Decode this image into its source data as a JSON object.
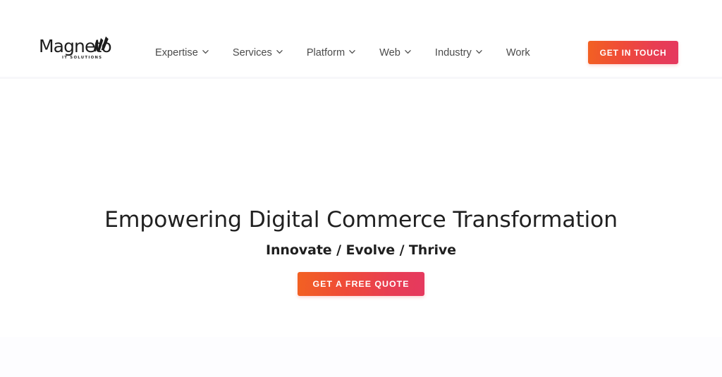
{
  "site": {
    "brand_name": "Magneto",
    "brand_tagline": "IT SOLUTIONS",
    "logo_icon": "magneto-swoosh-icon"
  },
  "header": {
    "nav_items": [
      {
        "label": "Expertise",
        "has_dropdown": true,
        "icon": "chevron-down-icon"
      },
      {
        "label": "Services",
        "has_dropdown": true,
        "icon": "chevron-down-icon"
      },
      {
        "label": "Platform",
        "has_dropdown": true,
        "icon": "chevron-down-icon"
      },
      {
        "label": "Web",
        "has_dropdown": true,
        "icon": "chevron-down-icon"
      },
      {
        "label": "Industry",
        "has_dropdown": true,
        "icon": "chevron-down-icon"
      },
      {
        "label": "Work",
        "has_dropdown": false,
        "icon": ""
      }
    ],
    "cta_label": "GET IN TOUCH"
  },
  "hero": {
    "title": "Empowering Digital Commerce Transformation",
    "subtitle": "Innovate / Evolve / Thrive",
    "cta_label": "GET A FREE QUOTE"
  },
  "colors": {
    "gradient_start": "#f26122",
    "gradient_end": "#e5395f",
    "nav_text": "#4b4b4b",
    "heading_text": "#212121",
    "page_background": "#ffffff",
    "band_background": "#fdfdff",
    "divider": "#f7f7fa"
  }
}
